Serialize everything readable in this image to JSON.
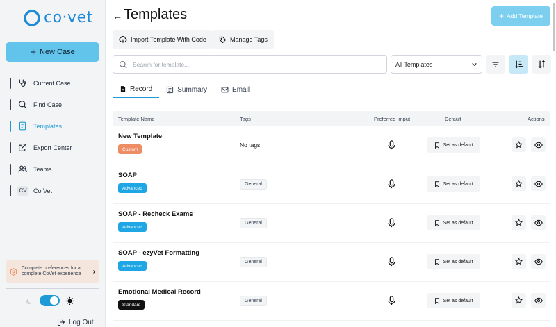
{
  "brand": {
    "logo_text": "co·vet",
    "accent": "#1e9bd7",
    "button_color": "#62c3eb"
  },
  "sidebar": {
    "new_case_label": "New Case",
    "items": [
      {
        "label": "Current Case",
        "icon": "stethoscope-icon"
      },
      {
        "label": "Find Case",
        "icon": "search-icon"
      },
      {
        "label": "Templates",
        "icon": "document-icon",
        "active": true
      },
      {
        "label": "Export Center",
        "icon": "export-icon"
      },
      {
        "label": "Teams",
        "icon": "users-icon"
      },
      {
        "label": "Co Vet",
        "icon": "avatar-cv",
        "badge": "CV"
      }
    ],
    "prefs_text": "Complete preferences for a complete CoVet experience",
    "logout_label": "Log Out"
  },
  "header": {
    "title": "Templates",
    "add_template_label": "Add Template",
    "import_label": "Import Template With Code",
    "manage_tags_label": "Manage Tags"
  },
  "search": {
    "placeholder": "Search for template...",
    "value": ""
  },
  "filter": {
    "selected": "All Templates"
  },
  "tabs": [
    {
      "label": "Record",
      "active": true
    },
    {
      "label": "Summary"
    },
    {
      "label": "Email"
    }
  ],
  "table": {
    "columns": {
      "name": "Template Name",
      "tags": "Tags",
      "input": "Preferred Imput",
      "default": "Default",
      "actions": "Actions"
    },
    "set_default_label": "Set as default",
    "rows": [
      {
        "name": "New Template",
        "badge": "Custom",
        "badge_color": "#ee8c63",
        "tags": "No tags"
      },
      {
        "name": "SOAP",
        "badge": "Advanced",
        "badge_color": "#1ea7e4",
        "tags": "General"
      },
      {
        "name": "SOAP - Recheck Exams",
        "badge": "Advanced",
        "badge_color": "#1ea7e4",
        "tags": "General"
      },
      {
        "name": "SOAP - ezyVet Formatting",
        "badge": "Advanced",
        "badge_color": "#1ea7e4",
        "tags": "General"
      },
      {
        "name": "Emotional Medical Record",
        "badge": "Standard",
        "badge_color": "#111111",
        "tags": "General"
      }
    ]
  }
}
